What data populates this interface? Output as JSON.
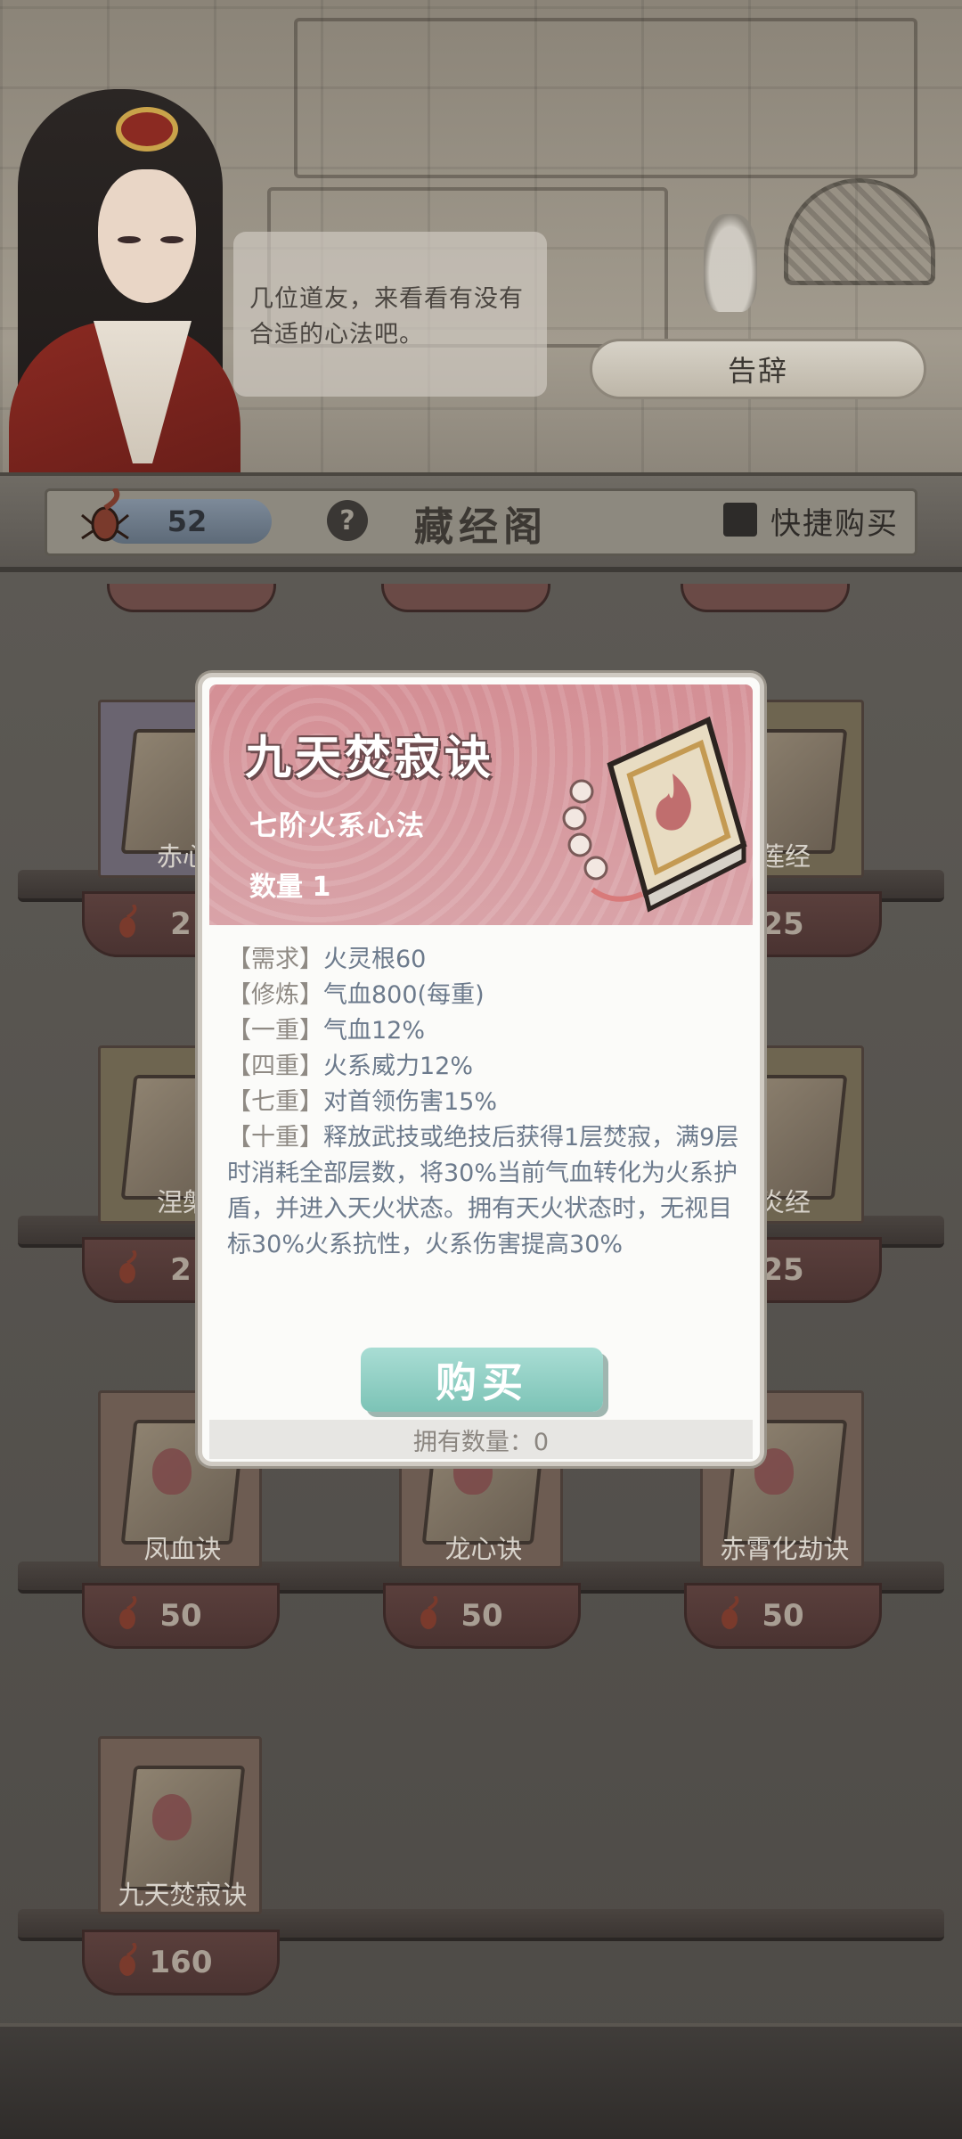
{
  "npc": {
    "dialogue": "几位道友，来看看有没有合适的心法吧。"
  },
  "actions": {
    "leave_label": "告辞"
  },
  "header": {
    "currency": "52",
    "help_label": "?",
    "title": "藏经阁",
    "quick_buy_label": "快捷购买"
  },
  "shop": {
    "items": [
      {
        "name": "赤心",
        "price": "2"
      },
      {
        "name": "莲经",
        "price": "25"
      },
      {
        "name": "涅槃",
        "price": "2"
      },
      {
        "name": "炎经",
        "price": "25"
      },
      {
        "name": "凤血诀",
        "price": "50"
      },
      {
        "name": "龙心诀",
        "price": "50"
      },
      {
        "name": "赤霄化劫诀",
        "price": "50"
      },
      {
        "name": "九天焚寂诀",
        "price": "160"
      }
    ]
  },
  "modal": {
    "title": "九天焚寂诀",
    "subtitle": "七阶火系心法",
    "quantity": "数量 1",
    "lines": [
      {
        "key": "【需求】",
        "value": "火灵根60"
      },
      {
        "key": "【修炼】",
        "value": "气血800(每重)"
      },
      {
        "key": "【一重】",
        "value": "气血12%"
      },
      {
        "key": "【四重】",
        "value": "火系威力12%"
      },
      {
        "key": "【七重】",
        "value": "对首领伤害15%"
      }
    ],
    "tenth_key": "【十重】",
    "tenth_value": "释放武技或绝技后获得1层焚寂，满9层时消耗全部层数，将30%当前气血转化为火系护盾，并进入天火状态。拥有天火状态时，无视目标30%火系抗性，火系伤害提高30%",
    "buy_label": "购买",
    "owned": "拥有数量：0"
  }
}
